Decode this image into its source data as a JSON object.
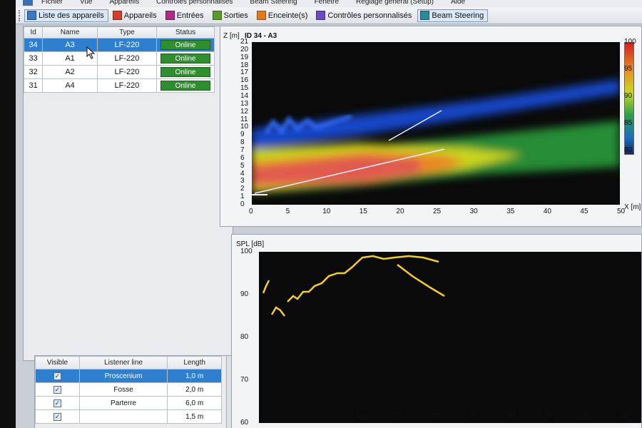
{
  "menu": [
    "Fichier",
    "Vue",
    "Appareils",
    "Contrôles personnalisés",
    "Beam Steering",
    "Fenêtre",
    "Réglage général (Setup)",
    "Aide"
  ],
  "toolbar": [
    {
      "label": "Liste des appareils",
      "color": "#3b78c4",
      "active": true
    },
    {
      "label": "Appareils",
      "color": "#d2402a",
      "active": false
    },
    {
      "label": "Entrées",
      "color": "#b02a8a",
      "active": false
    },
    {
      "label": "Sorties",
      "color": "#5a9a2a",
      "active": false
    },
    {
      "label": "Enceinte(s)",
      "color": "#e07a1a",
      "active": false
    },
    {
      "label": "Contrôles personnalisés",
      "color": "#6a4ac0",
      "active": false
    },
    {
      "label": "Beam Steering",
      "color": "#2a8a9a",
      "active": true
    }
  ],
  "devices": {
    "columns": [
      "Id",
      "Name",
      "Type",
      "Status"
    ],
    "rows": [
      {
        "id": "34",
        "name": "A3",
        "type": "LF-220",
        "status": "Online",
        "selected": true
      },
      {
        "id": "33",
        "name": "A1",
        "type": "LF-220",
        "status": "Online",
        "selected": false
      },
      {
        "id": "32",
        "name": "A2",
        "type": "LF-220",
        "status": "Online",
        "selected": false
      },
      {
        "id": "31",
        "name": "A4",
        "type": "LF-220",
        "status": "Online",
        "selected": false
      }
    ]
  },
  "listener": {
    "columns": [
      "Visible",
      "Listener line",
      "Length"
    ],
    "rows": [
      {
        "line": "Proscenium",
        "length": "1,0 m",
        "selected": true
      },
      {
        "line": "Fosse",
        "length": "2,0 m",
        "selected": false
      },
      {
        "line": "Parterre",
        "length": "6,0 m",
        "selected": false
      },
      {
        "line": "",
        "length": "1,5 m",
        "selected": false
      }
    ]
  },
  "heatmap": {
    "y_label": "Z [m]",
    "title": "ID 34 - A3",
    "x_label": "X [m]",
    "y_ticks": [
      "21",
      "20",
      "19",
      "18",
      "17",
      "16",
      "15",
      "14",
      "13",
      "12",
      "11",
      "10",
      "9",
      "8",
      "7",
      "6",
      "5",
      "4",
      "3",
      "2",
      "1",
      "0"
    ],
    "x_ticks": [
      "0",
      "5",
      "10",
      "15",
      "20",
      "25",
      "30",
      "35",
      "40",
      "45",
      "50"
    ],
    "colorbar_ticks": [
      "100",
      "95",
      "90",
      "85",
      "80"
    ]
  },
  "spl": {
    "y_label": "SPL [dB]",
    "y_ticks": [
      "100",
      "90",
      "80",
      "70",
      "60"
    ],
    "x_ticks": [
      "10",
      "15",
      "20",
      "25",
      "30",
      "35",
      "40",
      "45"
    ]
  }
}
